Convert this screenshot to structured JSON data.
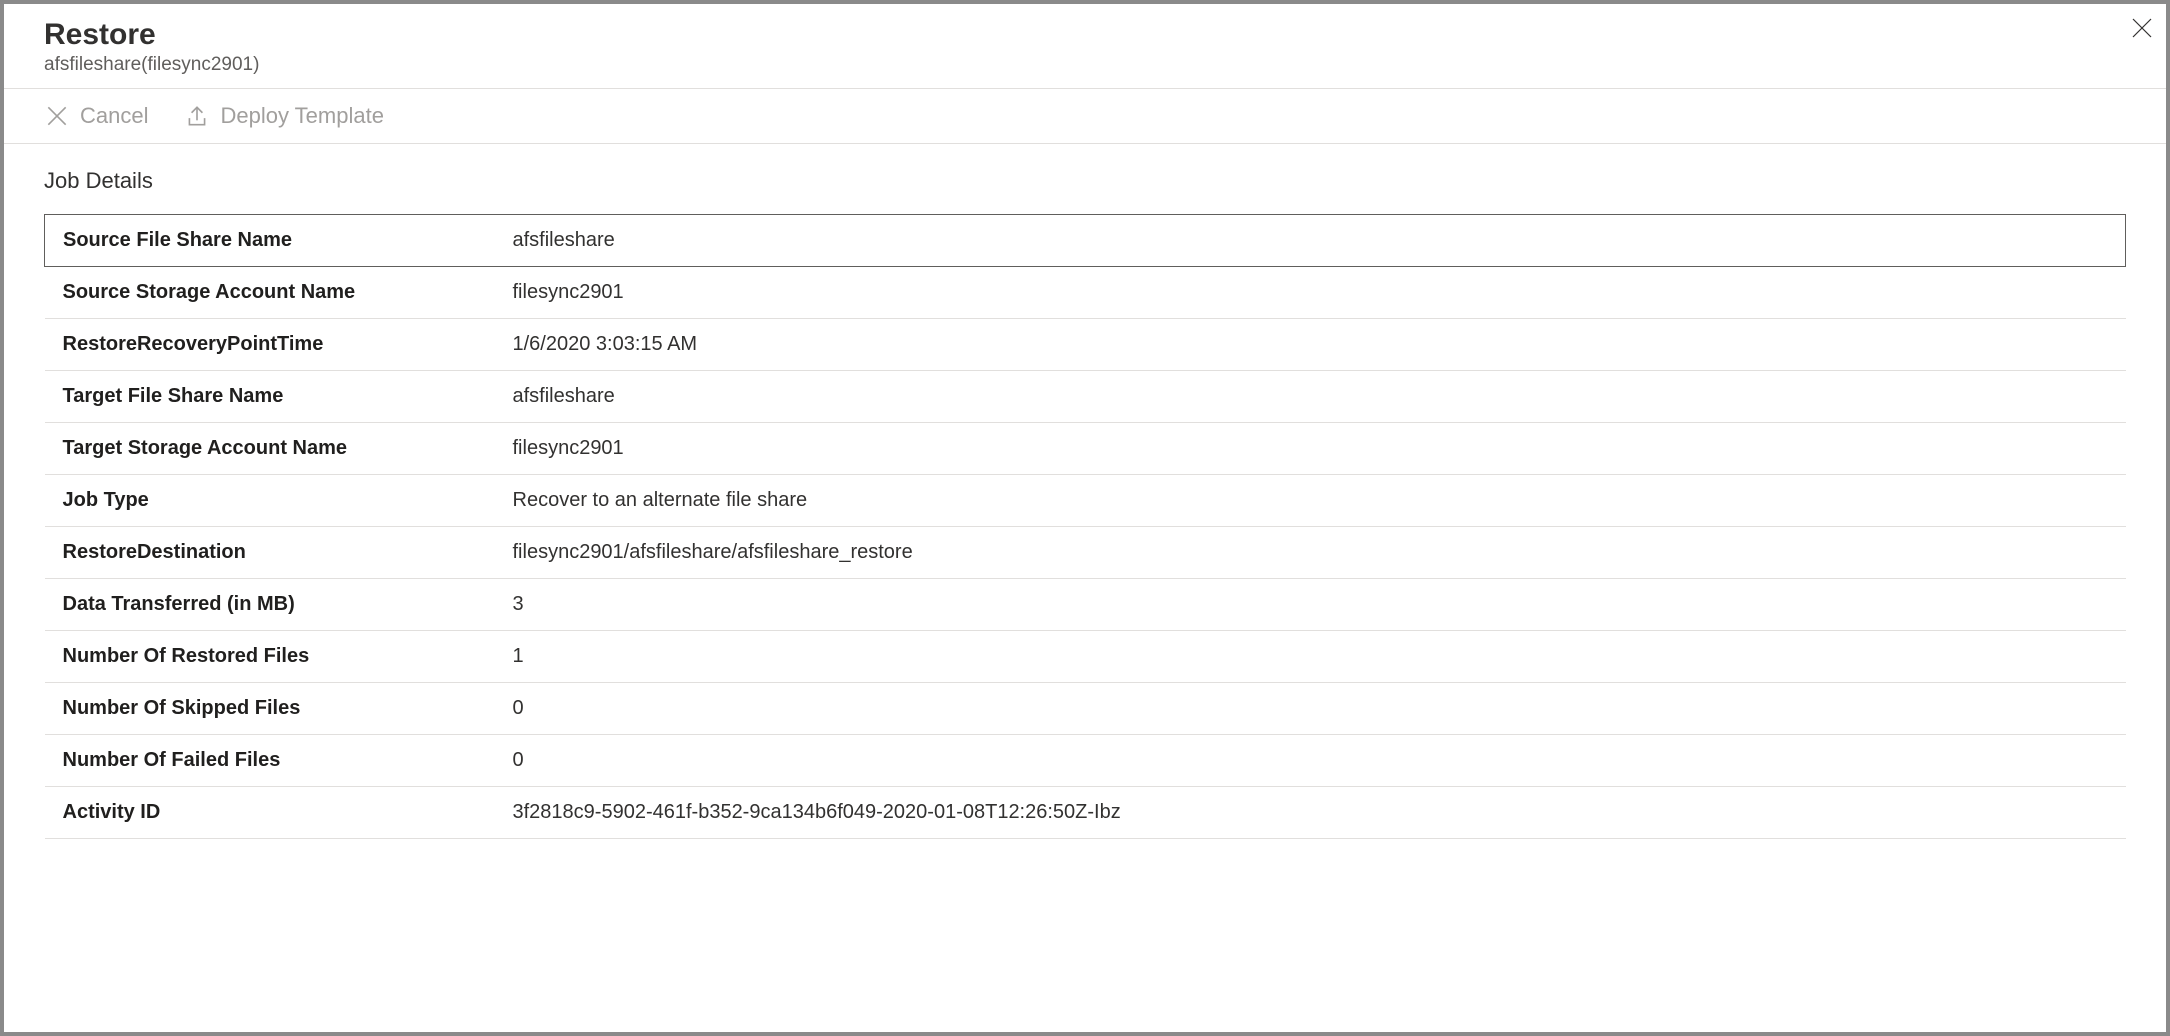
{
  "header": {
    "title": "Restore",
    "subtitle": "afsfileshare(filesync2901)"
  },
  "toolbar": {
    "cancel_label": "Cancel",
    "deploy_label": "Deploy Template"
  },
  "section": {
    "title": "Job Details"
  },
  "details": [
    {
      "label": "Source File Share Name",
      "value": "afsfileshare"
    },
    {
      "label": "Source Storage Account Name",
      "value": "filesync2901"
    },
    {
      "label": "RestoreRecoveryPointTime",
      "value": "1/6/2020 3:03:15 AM"
    },
    {
      "label": "Target File Share Name",
      "value": "afsfileshare"
    },
    {
      "label": "Target Storage Account Name",
      "value": "filesync2901"
    },
    {
      "label": "Job Type",
      "value": "Recover to an alternate file share"
    },
    {
      "label": "RestoreDestination",
      "value": "filesync2901/afsfileshare/afsfileshare_restore"
    },
    {
      "label": "Data Transferred (in MB)",
      "value": "3"
    },
    {
      "label": "Number Of Restored Files",
      "value": "1"
    },
    {
      "label": "Number Of Skipped Files",
      "value": "0"
    },
    {
      "label": "Number Of Failed Files",
      "value": "0"
    },
    {
      "label": "Activity ID",
      "value": "3f2818c9-5902-461f-b352-9ca134b6f049-2020-01-08T12:26:50Z-Ibz"
    }
  ]
}
